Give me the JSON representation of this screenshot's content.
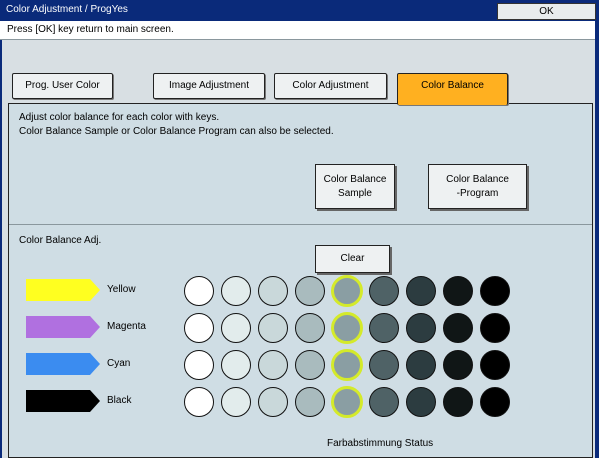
{
  "window": {
    "title": "Color Adjustment / ProgYes",
    "ok_label": "OK"
  },
  "message": "Press [OK] key return to main screen.",
  "tabs": [
    {
      "label": "Prog. User Color",
      "active": false
    },
    {
      "label": "Image Adjustment",
      "active": false
    },
    {
      "label": "Color Adjustment",
      "active": false
    },
    {
      "label": "Color Balance",
      "active": true
    }
  ],
  "instructions": [
    "Adjust color balance for each color with keys.",
    "Color Balance Sample or Color Balance Program can also be selected."
  ],
  "buttons": {
    "sample": {
      "line1": "Color Balance",
      "line2": "Sample"
    },
    "program": {
      "line1": "Color Balance",
      "line2": "-Program"
    },
    "clear": "Clear"
  },
  "section_label": "Color Balance Adj.",
  "status_label": "Farbabstimmung Status",
  "colors": {
    "accent_tab": "#ffb020",
    "title_bar": "#0a2a7a",
    "selected_ring": "#d4ea2a"
  },
  "balance_rows": [
    {
      "name": "Yellow",
      "swatch": "#ffff20",
      "selected_step": 5
    },
    {
      "name": "Magenta",
      "swatch": "#b070e0",
      "selected_step": 5
    },
    {
      "name": "Cyan",
      "swatch": "#3b8cf0",
      "selected_step": 5
    },
    {
      "name": "Black",
      "swatch": "#000000",
      "selected_step": 5
    }
  ],
  "steps": 9,
  "step_shades": [
    "#ffffff",
    "#e2ecec",
    "#c9d8da",
    "#a9bbbe",
    "#8a9ea3",
    "#4f6266",
    "#2c3c40",
    "#101616",
    "#000000"
  ]
}
